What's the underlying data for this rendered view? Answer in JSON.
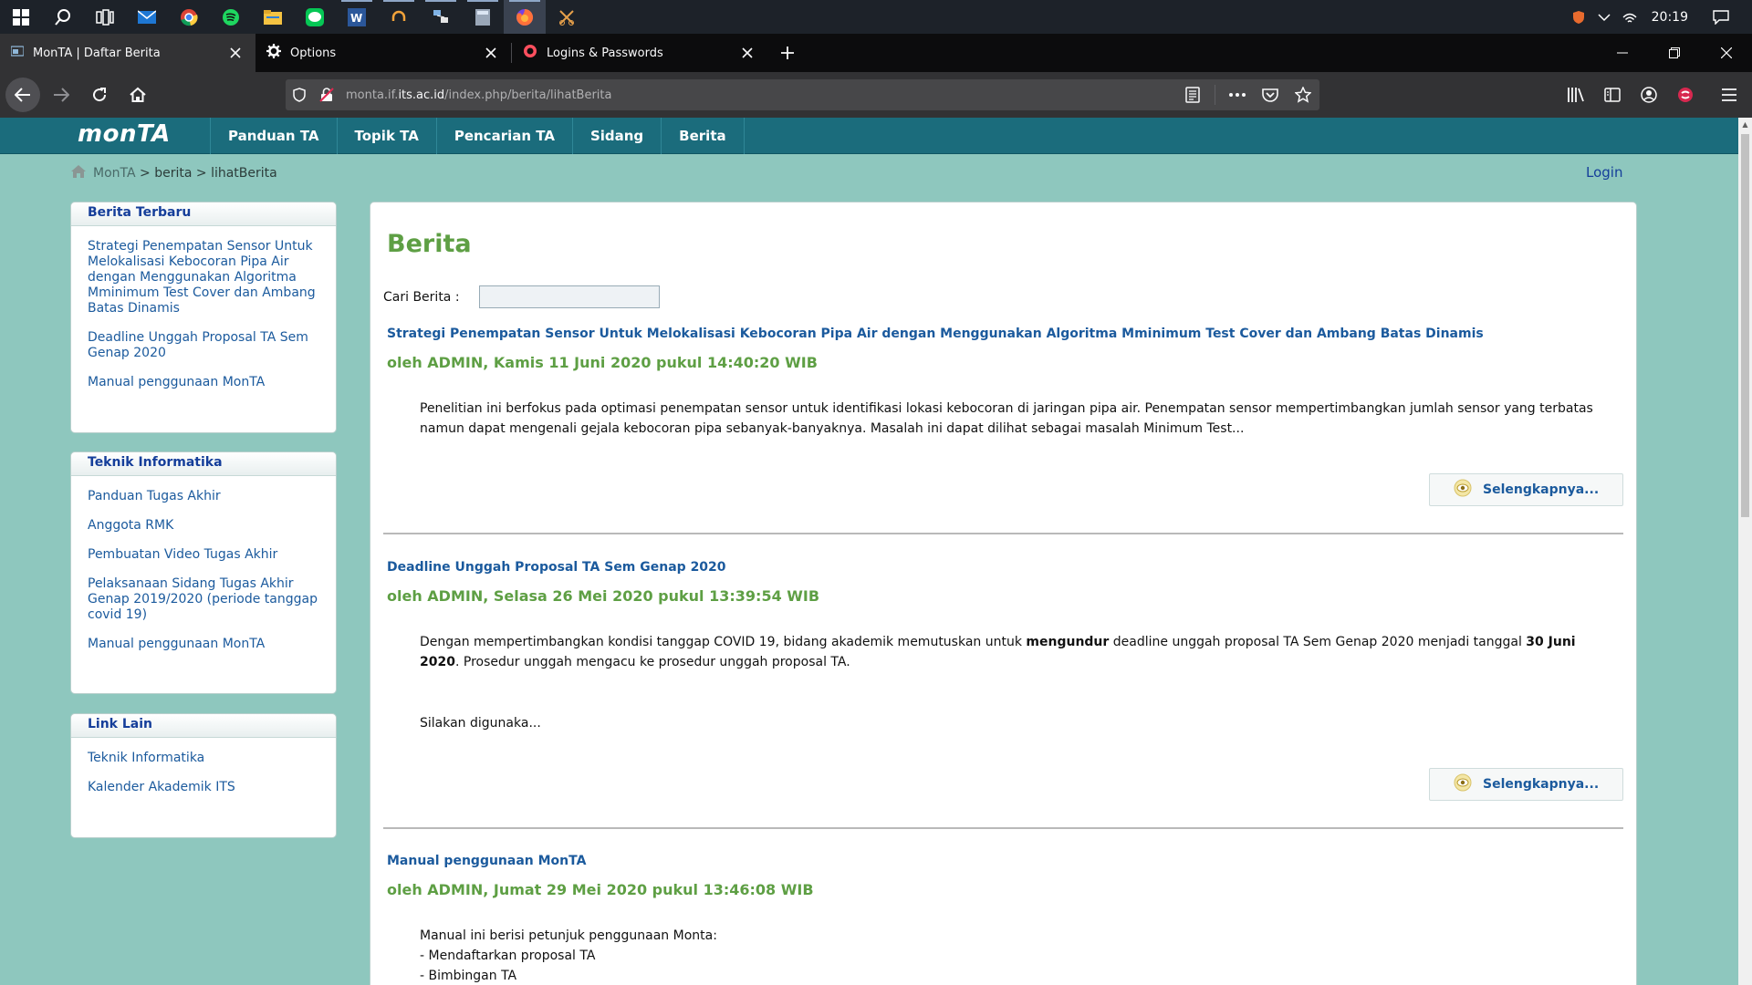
{
  "taskbar": {
    "apps": [
      "windows-icon",
      "search-icon",
      "task-view-icon",
      "mail-icon",
      "chrome-icon",
      "spotify-icon",
      "file-explorer-icon",
      "line-icon",
      "word-icon",
      "headphones-icon",
      "network-app-icon",
      "calculator-icon",
      "firefox-icon",
      "snipping-tool-icon"
    ],
    "clock": "20:19"
  },
  "tabs": [
    {
      "title": "MonTA | Daftar Berita",
      "selected": true
    },
    {
      "title": "Options",
      "selected": false
    },
    {
      "title": "Logins & Passwords",
      "selected": false
    }
  ],
  "url": {
    "prefix": "monta.if.",
    "host": "its.ac.id",
    "path": "/index.php/berita/lihatBerita"
  },
  "site": {
    "logo": "monTA",
    "menu": [
      "Panduan TA",
      "Topik TA",
      "Pencarian TA",
      "Sidang",
      "Berita"
    ],
    "breadcrumb": {
      "home": "MonTA",
      "sep1": " > ",
      "section": "berita",
      "sep2": " > ",
      "page": "lihatBerita"
    },
    "login": "Login"
  },
  "sidebar": {
    "terbaru": {
      "title": "Berita Terbaru",
      "items": [
        "Strategi Penempatan Sensor Untuk Melokalisasi Kebocoran Pipa Air dengan Menggunakan Algoritma Mminimum Test Cover dan Ambang Batas Dinamis",
        "Deadline Unggah Proposal TA Sem Genap 2020",
        "Manual penggunaan MonTA"
      ]
    },
    "ti": {
      "title": "Teknik Informatika",
      "items": [
        "Panduan Tugas Akhir",
        "Anggota RMK",
        "Pembuatan Video Tugas Akhir",
        "Pelaksanaan Sidang Tugas Akhir Genap 2019/2020 (periode tanggap covid 19)",
        "Manual penggunaan MonTA"
      ]
    },
    "links": {
      "title": "Link Lain",
      "items": [
        "Teknik Informatika",
        "Kalender Akademik ITS"
      ]
    }
  },
  "content": {
    "heading": "Berita",
    "search_label": "Cari Berita :",
    "search_value": "",
    "more_label": "Selengkapnya...",
    "news": [
      {
        "title": "Strategi Penempatan Sensor Untuk Melokalisasi Kebocoran Pipa Air dengan Menggunakan Algoritma Mminimum Test Cover dan Ambang Batas Dinamis",
        "meta": "oleh ADMIN, Kamis 11 Juni 2020 pukul 14:40:20 WIB",
        "body": "Penelitian ini berfokus pada optimasi penempatan sensor untuk identifikasi lokasi kebocoran di jaringan pipa air. Penempatan sensor mempertimbangkan jumlah sensor yang terbatas namun dapat mengenali gejala kebocoran pipa sebanyak-banyaknya. Masalah ini dapat dilihat sebagai masalah Minimum Test..."
      },
      {
        "title": "Deadline Unggah Proposal TA Sem Genap 2020",
        "meta": "oleh ADMIN, Selasa 26 Mei 2020 pukul 13:39:54 WIB",
        "body_p1": "Dengan mempertimbangkan kondisi tanggap COVID 19, bidang akademik memutuskan untuk ",
        "body_b1": "mengundur",
        "body_p2": " deadline unggah proposal TA Sem Genap 2020 menjadi tanggal ",
        "body_b2": "30 Juni 2020",
        "body_p3": ". Prosedur unggah mengacu ke prosedur unggah proposal TA.",
        "body_more": "Silakan digunaka..."
      },
      {
        "title": "Manual penggunaan MonTA",
        "meta": "oleh ADMIN, Jumat 29 Mei 2020 pukul 13:46:08 WIB",
        "body_l1": "Manual ini berisi petunjuk penggunaan Monta:",
        "body_l2": "- Mendaftarkan proposal TA",
        "body_l3": "- Bimbingan TA"
      }
    ]
  }
}
